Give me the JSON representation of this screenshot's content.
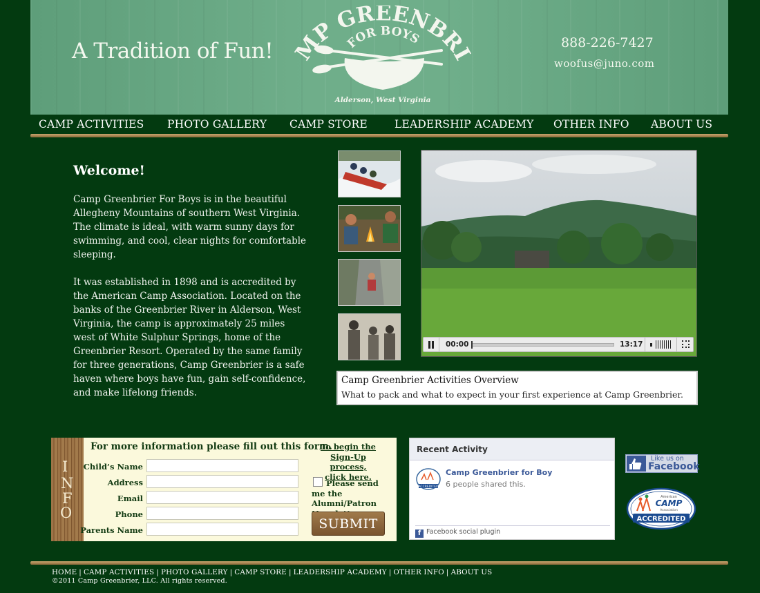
{
  "header": {
    "tagline": "A Tradition of Fun!",
    "logo_top": "CAMP GREENBRIER",
    "logo_mid": "FOR BOYS",
    "logo_location": "Alderson, West Virginia",
    "phone": "888-226-7427",
    "email": "woofus@juno.com"
  },
  "nav": [
    "CAMP ACTIVITIES",
    "PHOTO GALLERY",
    "CAMP STORE",
    "LEADERSHIP ACADEMY",
    "OTHER INFO",
    "ABOUT US"
  ],
  "welcome": {
    "title": "Welcome!",
    "para1": "Camp Greenbrier For Boys is in the beautiful Allegheny Mountains of southern West Virginia. The climate is ideal, with warm sunny days for swimming, and cool, clear nights for comfortable sleeping.",
    "para2": "It was established in 1898 and is accredited by the American Camp Association. Located on the banks of the Greenbrier River in Alderson, West Virginia, the camp is approximately 25 miles west of White Sulphur Springs, home of the Greenbrier Resort. Operated by the same family for three generations, Camp Greenbrier is a safe haven where boys have fun, gain self-confidence, and make lifelong friends."
  },
  "video": {
    "current_time": "00:00",
    "duration": "13:17",
    "progress": 0
  },
  "caption": {
    "title": "Camp Greenbrier Activities Overview",
    "description": "What to pack and what to expect in your first experience at Camp Greenbrier."
  },
  "form": {
    "side_letters": [
      "I",
      "N",
      "F",
      "O"
    ],
    "heading": "For more information please fill out this form.",
    "fields": [
      {
        "label": "Child’s Name",
        "value": ""
      },
      {
        "label": "Address",
        "value": ""
      },
      {
        "label": "Email",
        "value": ""
      },
      {
        "label": "Phone",
        "value": ""
      },
      {
        "label": "Parents Name",
        "value": ""
      }
    ],
    "signup_lines": [
      "To begin the",
      "Sign-Up process,",
      "click here."
    ],
    "newsletter": "Please send me the Alumni/Patron Newsletter.",
    "newsletter_checked": false,
    "submit": "SUBMIT"
  },
  "facebook": {
    "header": "Recent Activity",
    "badge_label": "ACCREDITED",
    "item_name": "Camp Greenbrier for Boy",
    "item_sub": "6 people shared this.",
    "footer": "Facebook social plugin",
    "like_line1": "Like us on",
    "like_line2": "Facebook"
  },
  "aca_badge": {
    "line1": "American",
    "line2": "CAMP",
    "line3": "Association",
    "line4": "ACCREDITED"
  },
  "footer": {
    "links": [
      "HOME",
      "CAMP ACTIVITIES",
      "PHOTO GALLERY",
      "CAMP STORE",
      "LEADERSHIP ACADEMY",
      "OTHER INFO",
      "ABOUT US"
    ],
    "copyright": "©2011 Camp Greenbrier, LLC. All rights reserved."
  },
  "colors": {
    "background": "#033a10",
    "header_green": "#6fae8a",
    "wood_bar": "#a88454",
    "form_bg": "#fbf9dc",
    "facebook_blue": "#3b5998"
  }
}
